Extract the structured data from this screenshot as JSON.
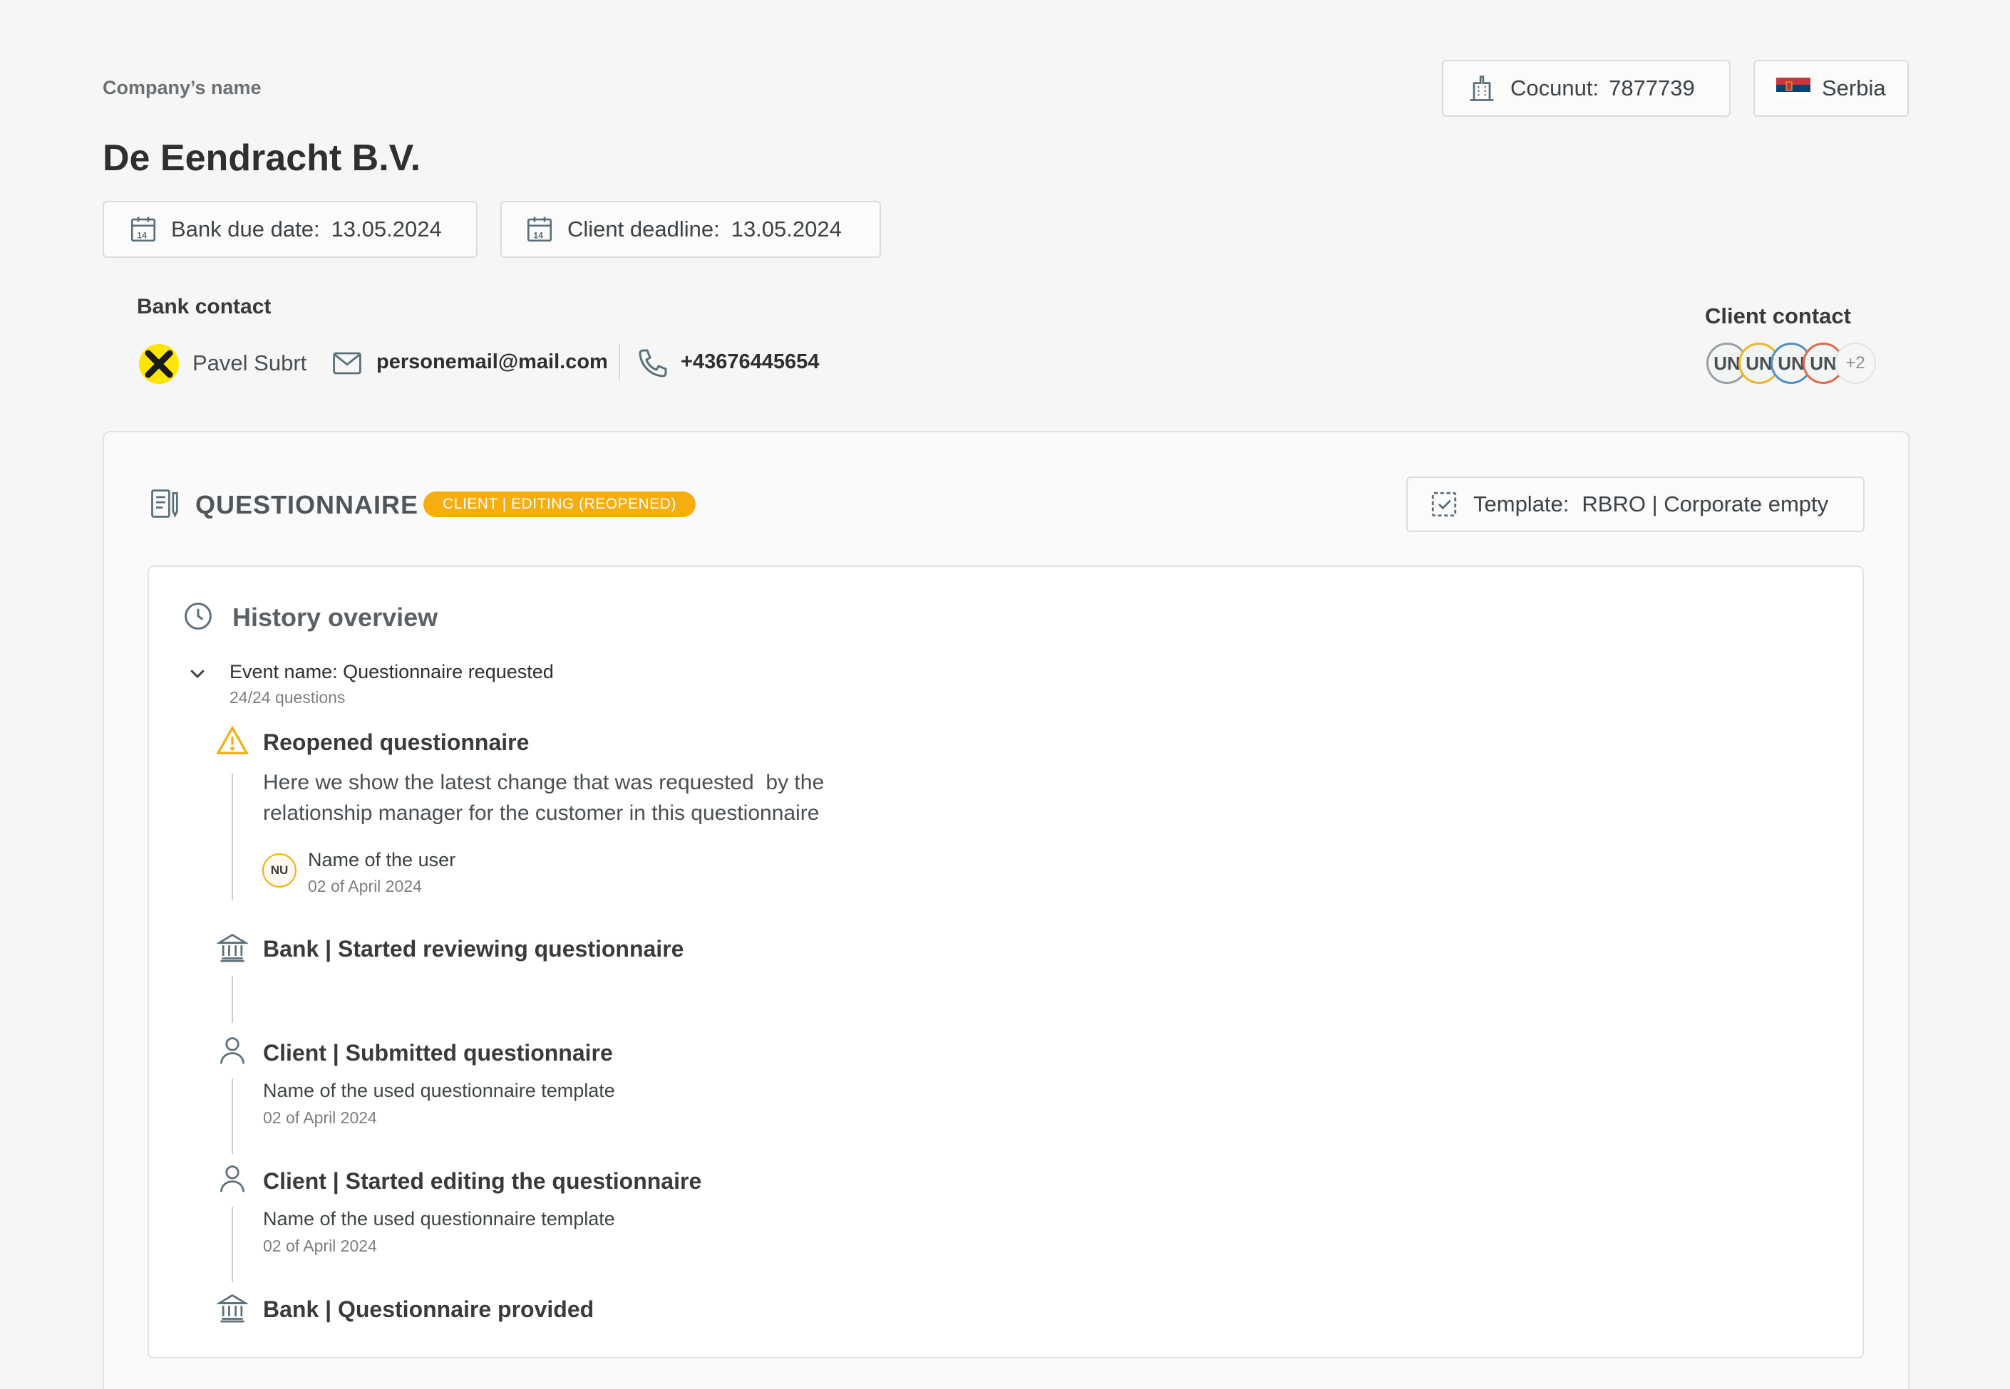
{
  "header": {
    "company_label": "Company’s name",
    "company_name": "De Eendracht B.V.",
    "cocunut_label": "Cocunut:",
    "cocunut_value": "7877739",
    "country": "Serbia",
    "bank_due_label": "Bank due date:",
    "bank_due_value": "13.05.2024",
    "client_deadline_label": "Client deadline:",
    "client_deadline_value": "13.05.2024"
  },
  "bank_contact": {
    "title": "Bank contact",
    "name": "Pavel Subrt",
    "email": "personemail@mail.com",
    "phone": "+43676445654"
  },
  "client_contact": {
    "title": "Client contact",
    "avatars": [
      "UN",
      "UN",
      "UN",
      "UN"
    ],
    "more": "+2",
    "colors": [
      "#9aa0a5",
      "#f0b429",
      "#4a90c8",
      "#e0684a"
    ]
  },
  "questionnaire": {
    "title": "QUESTIONNAIRE",
    "status": "CLIENT | EDITING (REOPENED)",
    "status_color": "#f5ad0f",
    "template_label": "Template:",
    "template_value": "RBRO | Corporate empty"
  },
  "history": {
    "title": "History overview",
    "event_name": "Event name: Questionnaire requested",
    "event_sub": "24/24 questions",
    "items": [
      {
        "icon": "warning-icon",
        "title": "Reopened questionnaire",
        "desc1": "Here we show the latest change that was requested  by the",
        "desc2": "relationship manager for the customer in this questionnaire",
        "user_initials": "NU",
        "user_name": "Name of the user",
        "date": "02 of April 2024"
      },
      {
        "icon": "bank-icon",
        "title": "Bank | Started reviewing questionnaire"
      },
      {
        "icon": "user-icon",
        "title": "Client | Submitted questionnaire",
        "sub": "Name of the used questionnaire template",
        "date": "02 of April 2024"
      },
      {
        "icon": "user-icon",
        "title": "Client | Started editing the questionnaire",
        "sub": "Name of the used questionnaire template",
        "date": "02 of April 2024"
      },
      {
        "icon": "bank-icon",
        "title": "Bank | Questionnaire provided"
      }
    ]
  }
}
